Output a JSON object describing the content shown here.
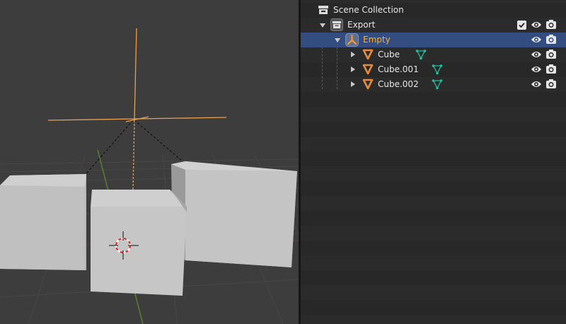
{
  "outliner": {
    "scene_collection": {
      "label": "Scene Collection",
      "icon": "scene-collection-icon"
    },
    "rows": [
      {
        "label": "Export",
        "type": "collection",
        "expanded": true,
        "selected": false,
        "icons": [
          "collection-icon"
        ],
        "toggles": [
          "checkbox-icon",
          "eye-icon",
          "camera-icon"
        ]
      },
      {
        "label": "Empty",
        "type": "empty",
        "expanded": true,
        "selected": true,
        "icons": [
          "empty-object-icon"
        ],
        "toggles": [
          "eye-icon",
          "camera-icon"
        ]
      },
      {
        "label": "Cube",
        "type": "mesh",
        "expanded": false,
        "selected": false,
        "icons": [
          "mesh-object-icon",
          "mesh-data-icon"
        ],
        "toggles": [
          "eye-icon",
          "camera-icon"
        ]
      },
      {
        "label": "Cube.001",
        "type": "mesh",
        "expanded": false,
        "selected": false,
        "icons": [
          "mesh-object-icon",
          "mesh-data-icon"
        ],
        "toggles": [
          "eye-icon",
          "camera-icon"
        ]
      },
      {
        "label": "Cube.002",
        "type": "mesh",
        "expanded": false,
        "selected": false,
        "icons": [
          "mesh-object-icon",
          "mesh-data-icon"
        ],
        "toggles": [
          "eye-icon",
          "camera-icon"
        ]
      }
    ]
  },
  "viewport": {
    "objects": [
      "empty-axes",
      "cube-left",
      "cube-center",
      "cube-right",
      "3d-cursor"
    ]
  },
  "colors": {
    "selected_row": "#334d80",
    "selected_text": "#ffaf29",
    "object_orange": "#e78a3c",
    "mesh_data_green": "#1fc2a0",
    "viewport_bg": "#3d3d3d",
    "outliner_bg": "#282828"
  }
}
